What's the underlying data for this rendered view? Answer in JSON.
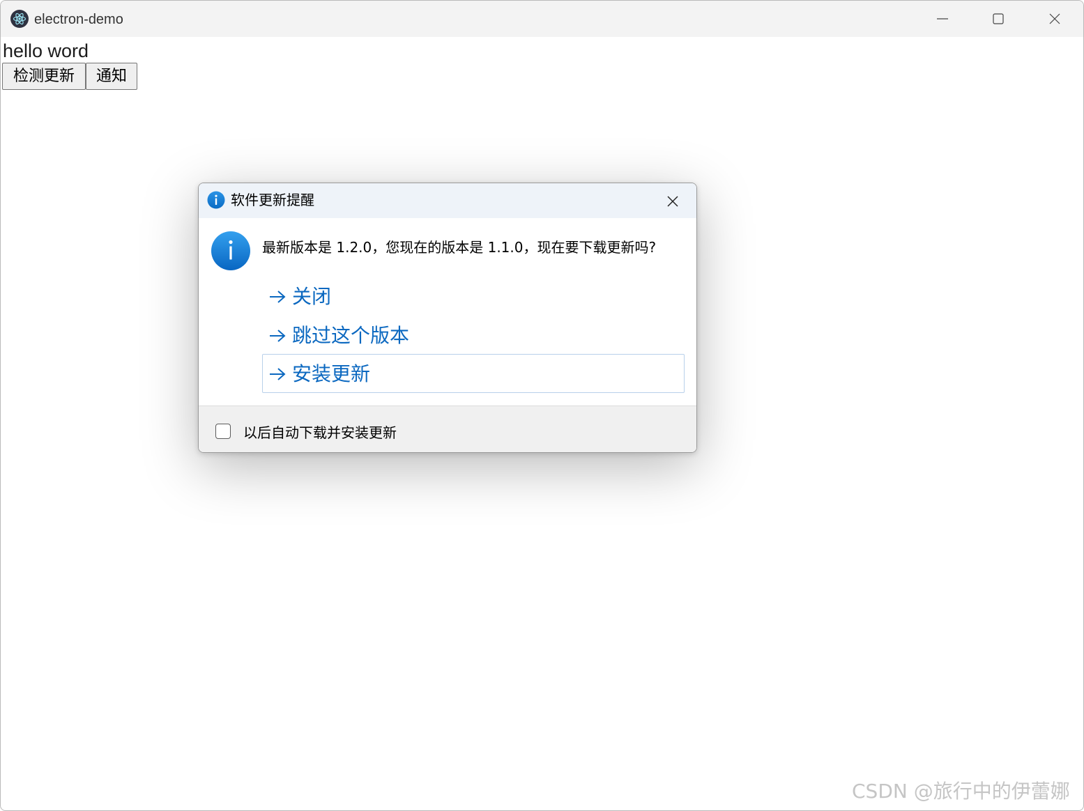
{
  "window": {
    "title": "electron-demo",
    "controls": {
      "minimize_icon": "minimize-icon",
      "maximize_icon": "maximize-icon",
      "close_icon": "close-icon"
    }
  },
  "page": {
    "heading": "hello word",
    "buttons": {
      "check_update": "检测更新",
      "notify": "通知"
    }
  },
  "dialog": {
    "title": "软件更新提醒",
    "title_icon": "info-icon",
    "message_icon": "info-icon",
    "message": "最新版本是 1.2.0，您现在的版本是 1.1.0，现在要下载更新吗?",
    "commands": [
      {
        "label": "关闭",
        "icon": "arrow-right-icon"
      },
      {
        "label": "跳过这个版本",
        "icon": "arrow-right-icon"
      },
      {
        "label": "安装更新",
        "icon": "arrow-right-icon",
        "focused": true
      }
    ],
    "footer": {
      "checkbox_label": "以后自动下载并安装更新",
      "checked": false
    }
  },
  "watermark": "CSDN @旅行中的伊蕾娜",
  "colors": {
    "accent": "#0b68c0",
    "info_icon": "#0a78d7",
    "titlebar": "#f3f3f3",
    "dialog_titlebar": "#eef3f9"
  }
}
